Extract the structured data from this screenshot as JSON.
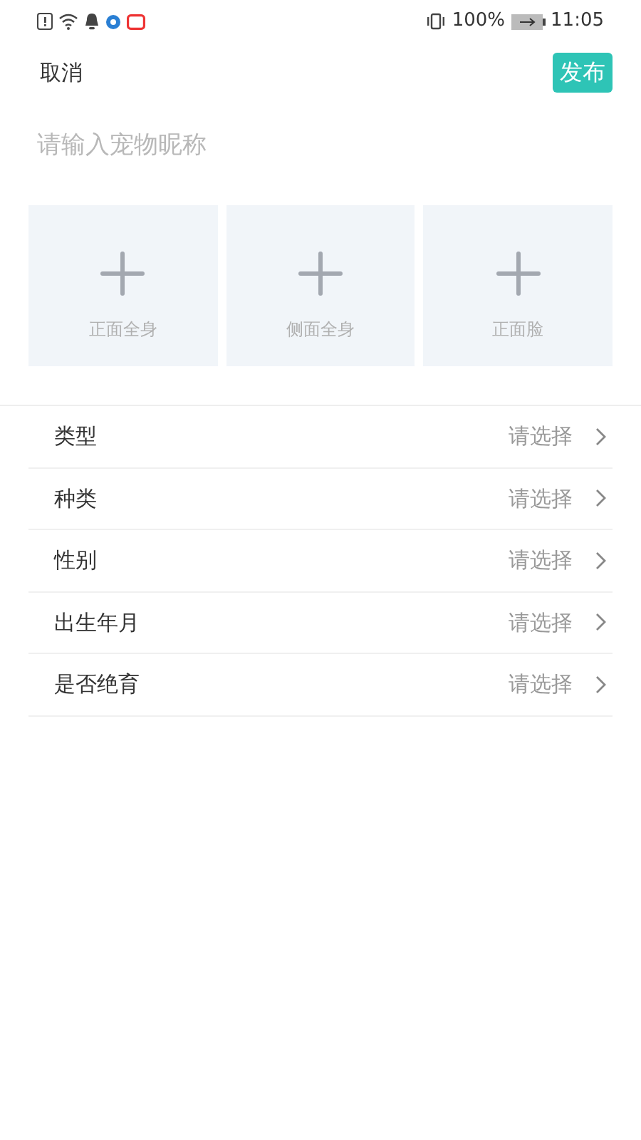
{
  "status_bar": {
    "battery_percent": "100%",
    "time": "11:05"
  },
  "header": {
    "cancel": "取消",
    "publish": "发布"
  },
  "name_field": {
    "placeholder": "请输入宠物昵称"
  },
  "photo_slots": [
    {
      "label": "正面全身"
    },
    {
      "label": "侧面全身"
    },
    {
      "label": "正面脸"
    }
  ],
  "form_rows": [
    {
      "label": "类型",
      "value": "请选择"
    },
    {
      "label": "种类",
      "value": "请选择"
    },
    {
      "label": "性别",
      "value": "请选择"
    },
    {
      "label": "出生年月",
      "value": "请选择"
    },
    {
      "label": "是否绝育",
      "value": "请选择"
    }
  ]
}
